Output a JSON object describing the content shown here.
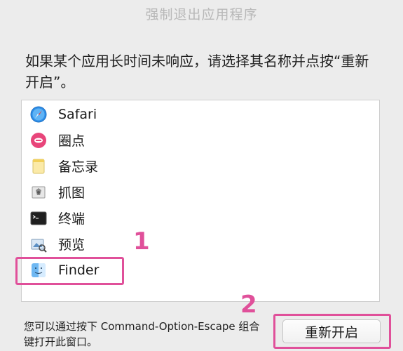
{
  "dialog": {
    "title": "强制退出应用程序",
    "instruction": "如果某个应用长时间未响应，请选择其名称并点按“重新开启”。",
    "footer_text": "您可以通过按下 Command-Option-Escape 组合键打开此窗口。",
    "relaunch_label": "重新开启"
  },
  "apps": [
    {
      "name": "Safari",
      "icon": "safari-icon"
    },
    {
      "name": "圈点",
      "icon": "skitch-icon"
    },
    {
      "name": "备忘录",
      "icon": "notes-icon"
    },
    {
      "name": "抓图",
      "icon": "grab-icon"
    },
    {
      "name": "终端",
      "icon": "terminal-icon"
    },
    {
      "name": "预览",
      "icon": "preview-icon"
    },
    {
      "name": "Finder",
      "icon": "finder-icon"
    }
  ],
  "annotations": {
    "marker_1": "1",
    "marker_2": "2",
    "color": "#e0509a"
  }
}
